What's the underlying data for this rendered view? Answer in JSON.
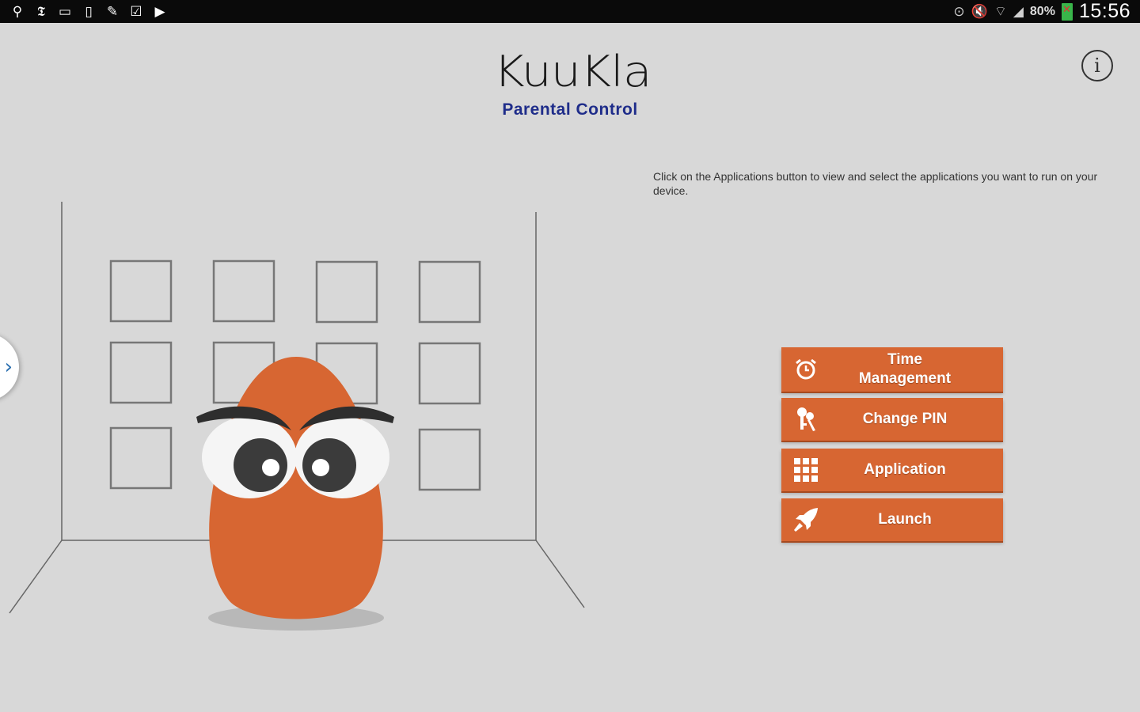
{
  "status_bar": {
    "left_icons": [
      "usb-icon",
      "news-icon",
      "image-icon",
      "sim-icon",
      "pencil-icon",
      "calendar-check-icon",
      "play-store-icon"
    ],
    "right_icons": [
      "nfc-icon",
      "mute-icon",
      "wifi-icon",
      "signal-icon"
    ],
    "battery": "80%",
    "time": "15:56"
  },
  "header": {
    "logo": "KuuKla",
    "subtitle": "Parental Control",
    "info_glyph": "i"
  },
  "hint_text": "Click on the Applications button to view and select the applications you want to run on your device.",
  "drawer_handle": "›",
  "buttons": {
    "time_management": "Time\nManagement",
    "change_pin": "Change PIN",
    "application": "Application",
    "launch": "Launch"
  },
  "colors": {
    "accent": "#d76632",
    "background": "#d8d8d8",
    "subtitle": "#1f2d8a"
  }
}
